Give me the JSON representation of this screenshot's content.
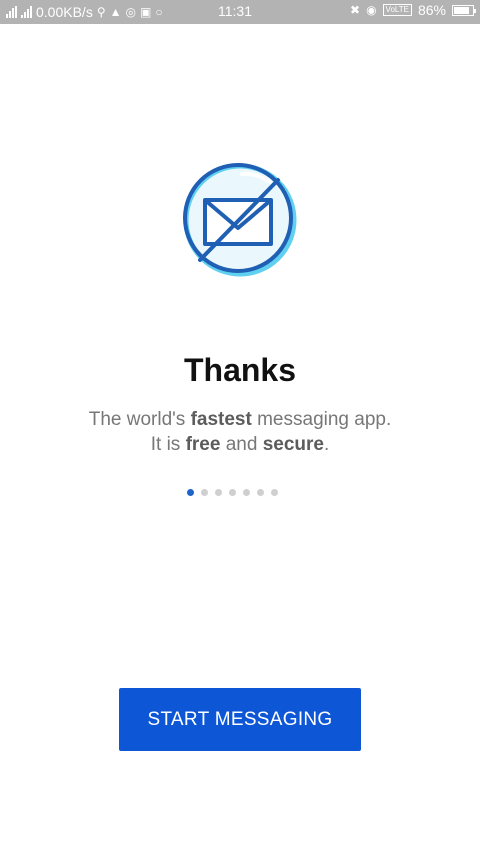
{
  "status_bar": {
    "network_speed": "0.00KB/s",
    "time": "11:31",
    "volte_label": "VoLTE",
    "battery_percent": "86%",
    "battery_level": 0.86
  },
  "onboarding": {
    "icon": "envelope-crossed-icon",
    "title": "Thanks",
    "line1_pre": "The world's ",
    "line1_bold": "fastest",
    "line1_post": " messaging app.",
    "line2_pre": "It is ",
    "line2_bold1": "free",
    "line2_mid": " and ",
    "line2_bold2": "secure",
    "line2_post": ".",
    "page_count": 7,
    "active_page": 1
  },
  "cta": {
    "label": "START MESSAGING"
  },
  "colors": {
    "accent": "#0d56d6",
    "dot_active": "#1e63c9",
    "dot_inactive": "#cfcfcf",
    "icon_blue": "#1f5fb4",
    "icon_cyan": "#5fd0f0"
  }
}
